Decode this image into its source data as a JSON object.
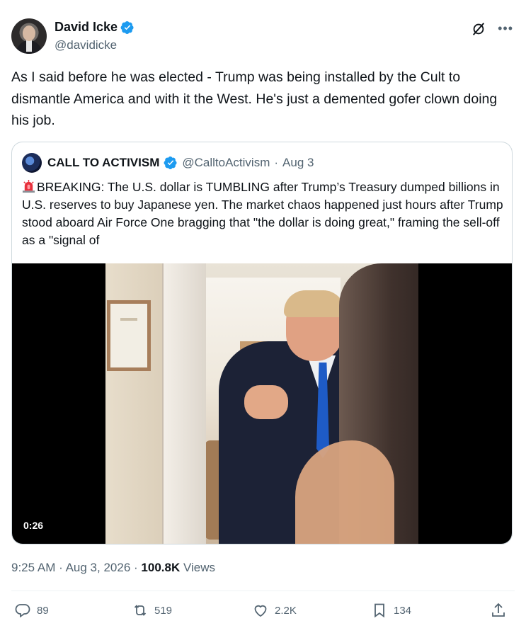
{
  "author": {
    "display_name": "David Icke",
    "handle": "@davidicke"
  },
  "tweet_text": "As I said before he was elected - Trump was being installed by the Cult to dismantle America and with it the West. He's just a demented gofer clown doing his job.",
  "quoted": {
    "display_name": "CALL TO ACTIVISM",
    "handle": "@CalltoActivism",
    "separator": "·",
    "date": "Aug 3",
    "text": "BREAKING: The U.S. dollar is TUMBLING after Trump’s Treasury dumped billions in U.S. reserves to buy Japanese yen.  The market chaos happened just hours after Trump stood aboard Air Force One bragging that \"the dollar is doing great,\" framing the sell-off as a \"signal of",
    "video_duration": "0:26"
  },
  "timestamp": {
    "time": "9:25 AM",
    "separator": "·",
    "date": "Aug 3, 2026",
    "separator2": "·",
    "views_count": "100.8K",
    "views_label": "Views"
  },
  "actions": {
    "replies": "89",
    "reposts": "519",
    "likes": "2.2K",
    "bookmarks": "134"
  },
  "colors": {
    "verified": "#1d9bf0",
    "text": "#0f1419",
    "secondary": "#536471",
    "border": "#cfd9de",
    "repost_green": "#00ba7c"
  },
  "icons": [
    "verified-badge-icon",
    "grok-icon",
    "more-icon",
    "siren-emoji-icon",
    "reply-icon",
    "repost-icon",
    "like-icon",
    "bookmark-icon",
    "share-icon"
  ]
}
